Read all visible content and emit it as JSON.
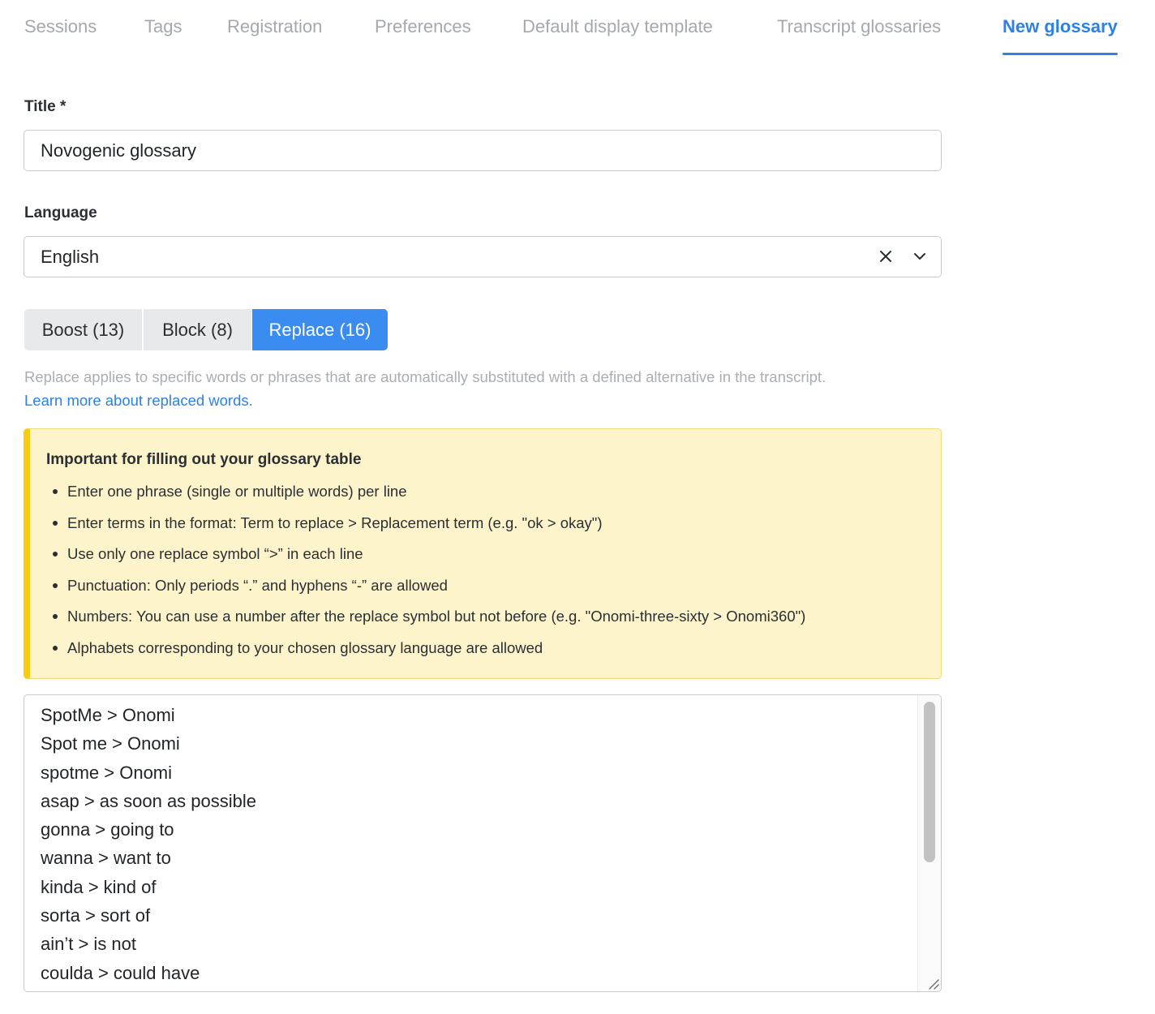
{
  "nav": {
    "tabs": [
      {
        "label": "Sessions"
      },
      {
        "label": "Tags"
      },
      {
        "label": "Registration"
      },
      {
        "label": "Preferences"
      },
      {
        "label": "Default display template"
      },
      {
        "label": "Transcript glossaries"
      },
      {
        "label": "New glossary"
      }
    ],
    "active_index": 6
  },
  "form": {
    "title_label": "Title *",
    "title_value": "Novogenic glossary",
    "language_label": "Language",
    "language_value": "English"
  },
  "modes": {
    "items": [
      {
        "label": "Boost (13)"
      },
      {
        "label": "Block (8)"
      },
      {
        "label": "Replace (16)"
      }
    ],
    "active_index": 2
  },
  "help": {
    "description": "Replace applies to specific words or phrases that are automatically substituted with a defined alternative in the transcript.",
    "learn_more": "Learn more about replaced words."
  },
  "notice": {
    "title": "Important for filling out your glossary table",
    "items": [
      "Enter one phrase (single or multiple words) per line",
      "Enter terms in the format: Term to replace > Replacement term (e.g. \"ok > okay\")",
      "Use only one replace symbol “>” in each line",
      "Punctuation: Only periods “.” and hyphens “-” are allowed",
      "Numbers: You can use a number after the replace symbol but not before (e.g. \"Onomi-three-sixty > Onomi360\")",
      "Alphabets corresponding to your chosen glossary language are allowed"
    ]
  },
  "glossary": {
    "lines": [
      "SpotMe > Onomi",
      "Spot me > Onomi",
      "spotme > Onomi",
      "asap > as soon as possible",
      "gonna > going to",
      "wanna > want to",
      "kinda > kind of",
      "sorta > sort of",
      "ain’t > is not",
      "coulda > could have"
    ]
  },
  "colors": {
    "accent": "#2c80e6",
    "active_segment": "#3a8cf0",
    "notice_bg": "#fef4cc",
    "notice_bar": "#fbcb11"
  }
}
